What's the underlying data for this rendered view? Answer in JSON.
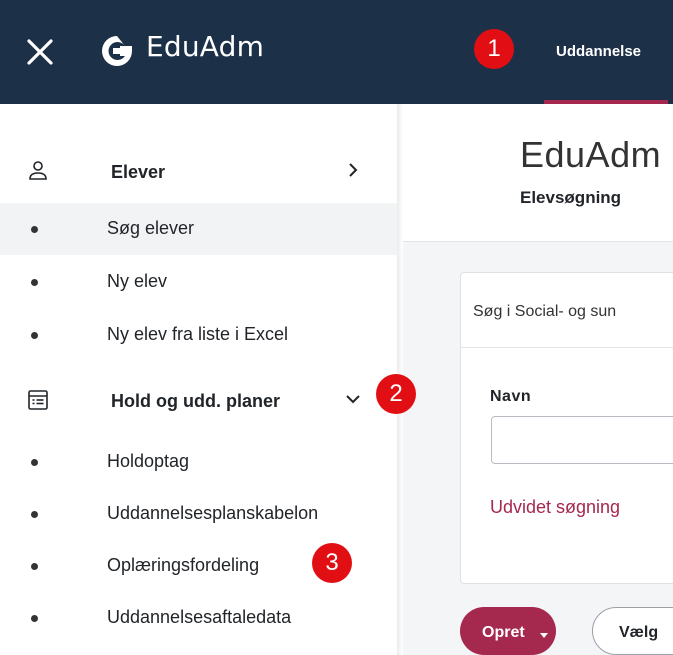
{
  "header": {
    "brand": "EduAdm",
    "nav_tab": "Uddannelse"
  },
  "markers": [
    "1",
    "2",
    "3"
  ],
  "sidebar": {
    "sections": [
      {
        "label": "Elever",
        "icon": "person-icon",
        "chevron": "chevron-right-icon",
        "items": [
          "Søg elever",
          "Ny elev",
          "Ny elev fra liste i Excel"
        ],
        "active_item": "Søg elever"
      },
      {
        "label": "Hold og udd. planer",
        "icon": "list-table-icon",
        "chevron": "chevron-down-icon",
        "items": [
          "Holdoptag",
          "Uddannelsesplanskabelon",
          "Oplæringsfordeling",
          "Uddannelsesaftaledata"
        ]
      }
    ]
  },
  "main": {
    "title": "EduAdm -",
    "subtitle": "Elevsøgning",
    "card_header": "Søg i Social- og sun",
    "field_label": "Navn",
    "field_value": "",
    "advanced_link": "Udvidet søgning",
    "create_button": "Opret",
    "choose_button": "Vælg"
  },
  "colors": {
    "topbar": "#1c3048",
    "accent": "#a5284f",
    "marker": "#e10f14"
  }
}
